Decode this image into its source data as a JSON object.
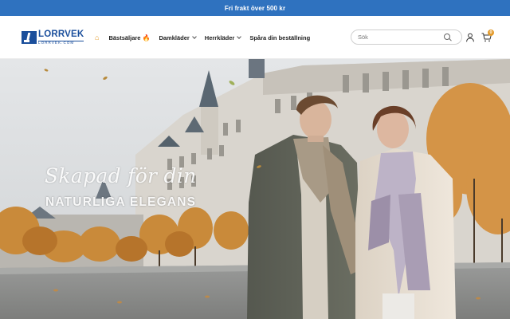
{
  "announcement": {
    "text": "Fri frakt över 500 kr"
  },
  "brand": {
    "name": "LORRVEK",
    "domain": "LORRVEK.COM",
    "color": "#1b4f9c"
  },
  "nav": {
    "home_icon": "home-icon",
    "items": [
      {
        "label": "Bästsäljare",
        "badge_icon": "fire-icon",
        "has_dropdown": false
      },
      {
        "label": "Damkläder",
        "has_dropdown": true
      },
      {
        "label": "Herrkläder",
        "has_dropdown": true
      },
      {
        "label": "Spåra din beställning",
        "has_dropdown": false
      }
    ]
  },
  "search": {
    "placeholder": "Sök",
    "icon": "search-icon"
  },
  "account": {
    "icon": "user-icon"
  },
  "cart": {
    "icon": "cart-icon",
    "count": "0"
  },
  "hero": {
    "script_text": "Skapad för din",
    "title": "NATURLIGA ELEGANS"
  },
  "colors": {
    "announcement_bg": "#2f72bf",
    "accent": "#e39b2d"
  }
}
